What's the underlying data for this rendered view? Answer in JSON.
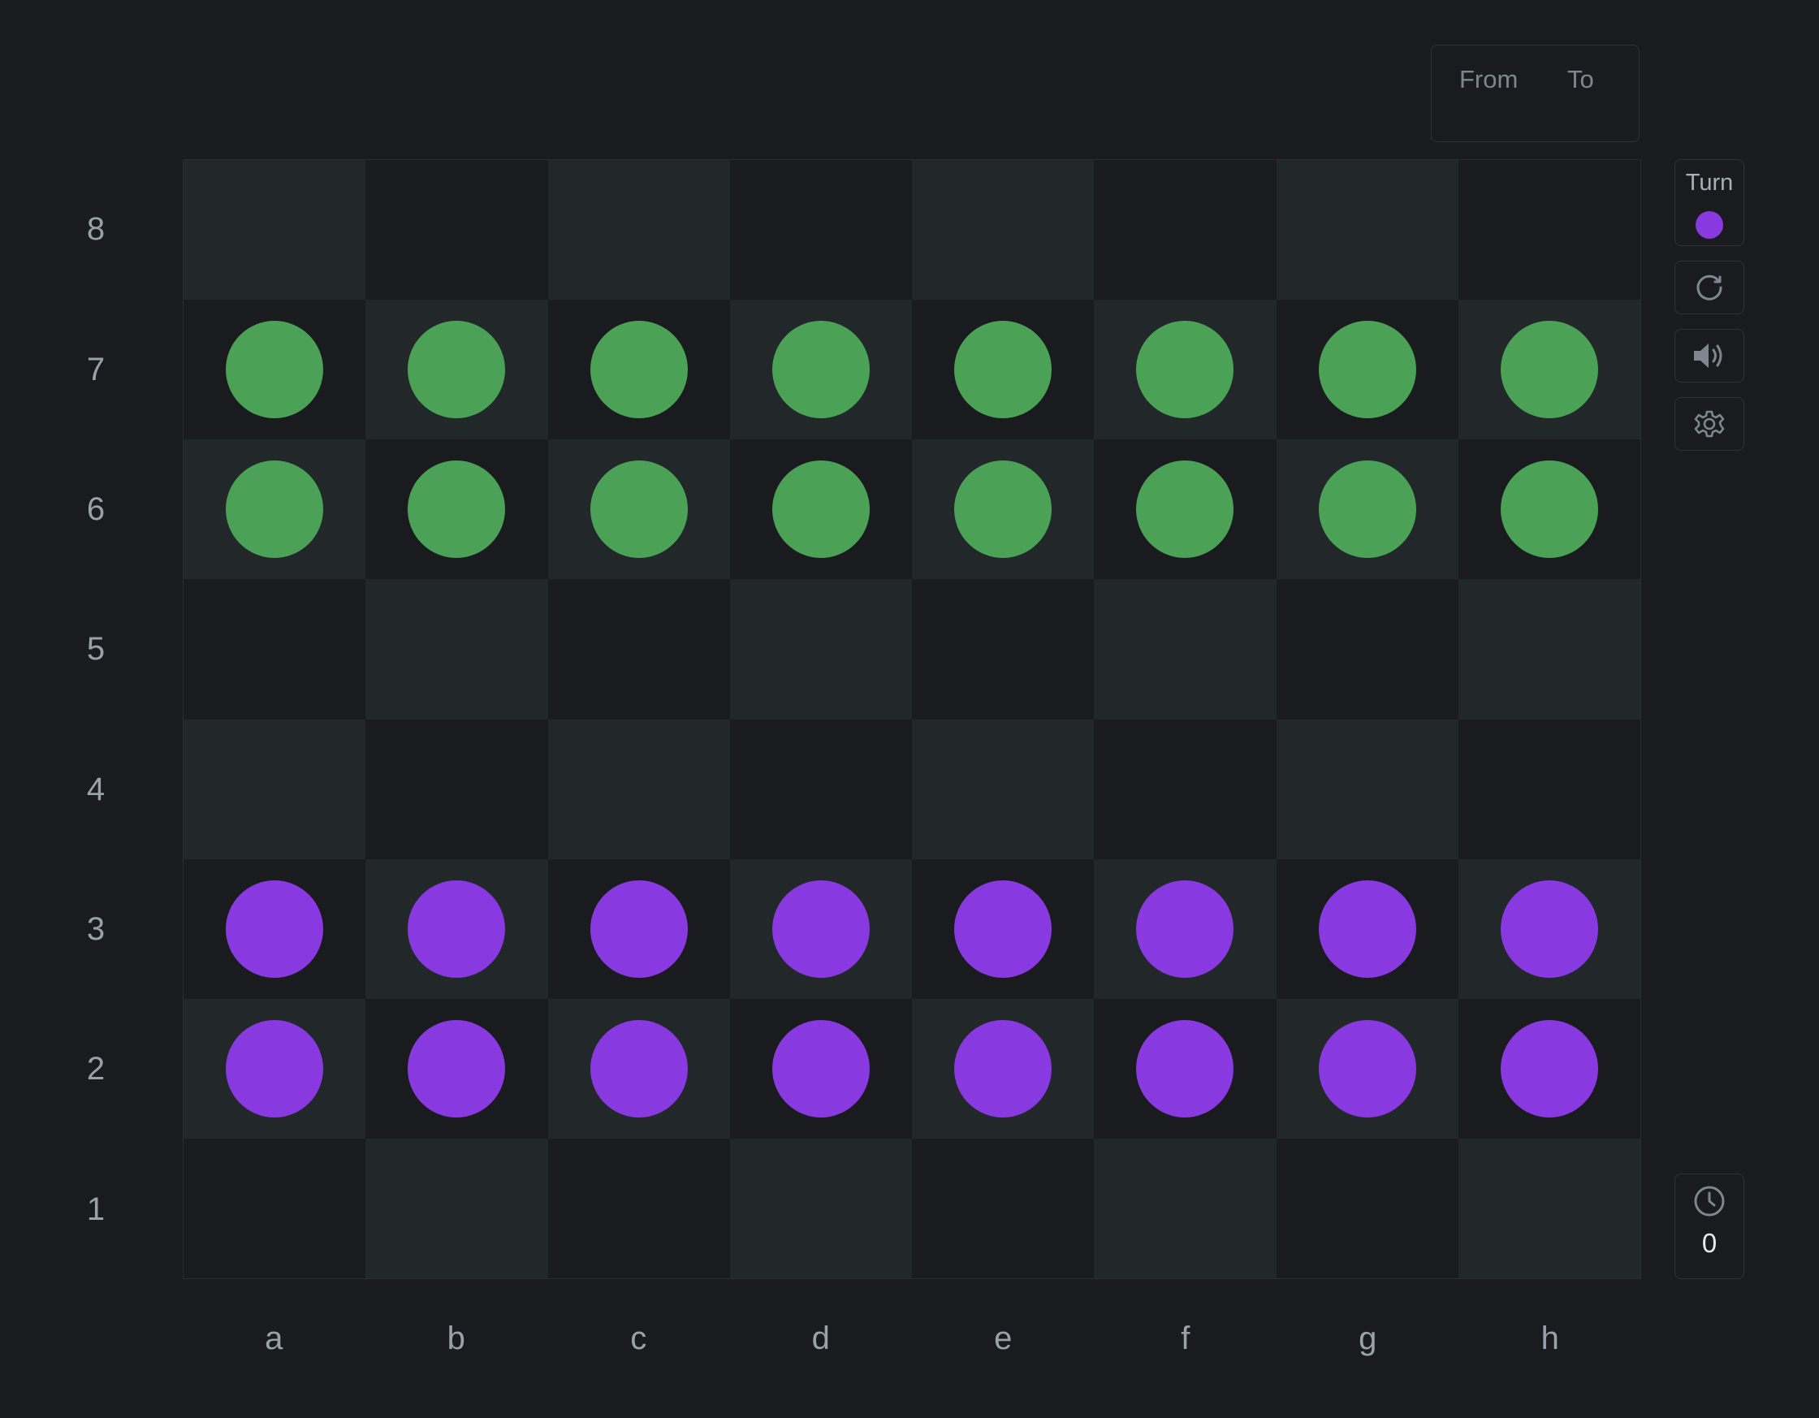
{
  "move_panel": {
    "from_label": "From",
    "to_label": "To"
  },
  "board": {
    "files": [
      "a",
      "b",
      "c",
      "d",
      "e",
      "f",
      "g",
      "h"
    ],
    "ranks": [
      "8",
      "7",
      "6",
      "5",
      "4",
      "3",
      "2",
      "1"
    ],
    "light_square_color": "#22272a",
    "dark_square_color": "#1a1b1e",
    "pieces": [
      {
        "square": "a7",
        "color": "green"
      },
      {
        "square": "b7",
        "color": "green"
      },
      {
        "square": "c7",
        "color": "green"
      },
      {
        "square": "d7",
        "color": "green"
      },
      {
        "square": "e7",
        "color": "green"
      },
      {
        "square": "f7",
        "color": "green"
      },
      {
        "square": "g7",
        "color": "green"
      },
      {
        "square": "h7",
        "color": "green"
      },
      {
        "square": "a6",
        "color": "green"
      },
      {
        "square": "b6",
        "color": "green"
      },
      {
        "square": "c6",
        "color": "green"
      },
      {
        "square": "d6",
        "color": "green"
      },
      {
        "square": "e6",
        "color": "green"
      },
      {
        "square": "f6",
        "color": "green"
      },
      {
        "square": "g6",
        "color": "green"
      },
      {
        "square": "h6",
        "color": "green"
      },
      {
        "square": "a3",
        "color": "purple"
      },
      {
        "square": "b3",
        "color": "purple"
      },
      {
        "square": "c3",
        "color": "purple"
      },
      {
        "square": "d3",
        "color": "purple"
      },
      {
        "square": "e3",
        "color": "purple"
      },
      {
        "square": "f3",
        "color": "purple"
      },
      {
        "square": "g3",
        "color": "purple"
      },
      {
        "square": "h3",
        "color": "purple"
      },
      {
        "square": "a2",
        "color": "purple"
      },
      {
        "square": "b2",
        "color": "purple"
      },
      {
        "square": "c2",
        "color": "purple"
      },
      {
        "square": "d2",
        "color": "purple"
      },
      {
        "square": "e2",
        "color": "purple"
      },
      {
        "square": "f2",
        "color": "purple"
      },
      {
        "square": "g2",
        "color": "purple"
      },
      {
        "square": "h2",
        "color": "purple"
      }
    ]
  },
  "piece_colors": {
    "green": "#4ba257",
    "purple": "#8839df"
  },
  "turn": {
    "label": "Turn",
    "player": "purple"
  },
  "controls": {
    "reset_icon": "reset-icon",
    "sound_icon": "sound-icon",
    "settings_icon": "gear-icon"
  },
  "timer": {
    "icon": "clock-icon",
    "value": "0"
  }
}
